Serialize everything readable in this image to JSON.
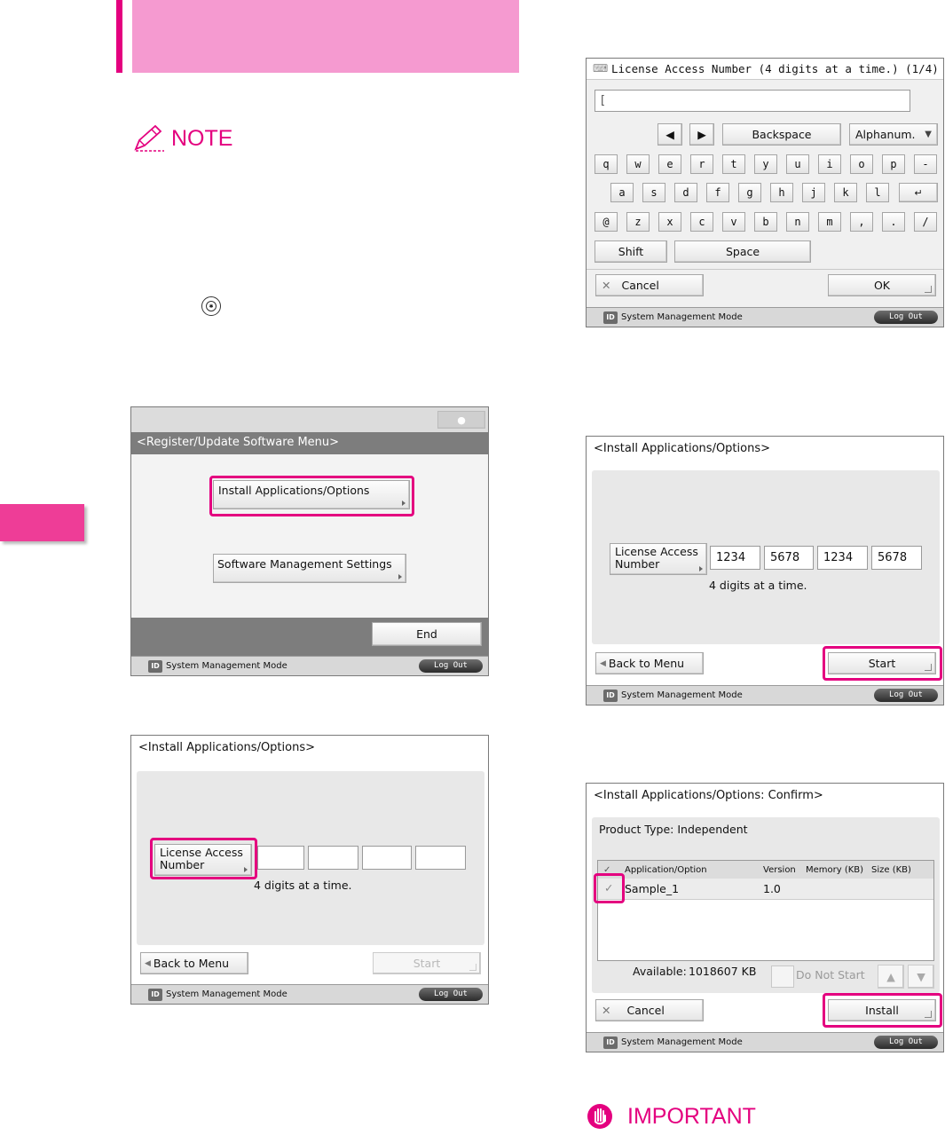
{
  "left_page": {
    "note_title": "NOTE",
    "screen_register": {
      "title": "<Register/Update Software Menu>",
      "install_button": "Install Applications/Options",
      "settings_button": "Software Management Settings",
      "end_button": "End",
      "status_text": "System Management Mode",
      "id_badge": "ID",
      "logout_button": "Log Out"
    },
    "screen_install_empty": {
      "title": "<Install Applications/Options>",
      "license_button_line1": "License Access",
      "license_button_line2": "Number",
      "hint": "4 digits at a time.",
      "back_button": "Back to Menu",
      "start_button": "Start",
      "status_text": "System Management Mode",
      "id_badge": "ID",
      "logout_button": "Log Out"
    }
  },
  "right_page": {
    "screen_keyboard": {
      "title": "License Access Number (4 digits at a time.) (1/4)",
      "input_value": "",
      "backspace": "Backspace",
      "mode": "Alphanum.",
      "row1": [
        "q",
        "w",
        "e",
        "r",
        "t",
        "y",
        "u",
        "i",
        "o",
        "p",
        "-"
      ],
      "row2": [
        "a",
        "s",
        "d",
        "f",
        "g",
        "h",
        "j",
        "k",
        "l"
      ],
      "row3": [
        "@",
        "z",
        "x",
        "c",
        "v",
        "b",
        "n",
        "m",
        ",",
        ".",
        "/"
      ],
      "shift": "Shift",
      "space": "Space",
      "cancel": "Cancel",
      "ok": "OK",
      "status_text": "System Management Mode",
      "id_badge": "ID",
      "logout_button": "Log Out"
    },
    "screen_install_filled": {
      "title": "<Install Applications/Options>",
      "license_button_line1": "License Access",
      "license_button_line2": "Number",
      "values": [
        "1234",
        "5678",
        "1234",
        "5678"
      ],
      "hint": "4 digits at a time.",
      "back_button": "Back to Menu",
      "start_button": "Start",
      "status_text": "System Management Mode",
      "id_badge": "ID",
      "logout_button": "Log Out"
    },
    "screen_confirm": {
      "title": "<Install Applications/Options: Confirm>",
      "product_type": "Product Type: Independent",
      "columns": [
        "Application/Option",
        "Version",
        "Memory (KB)",
        "Size (KB)"
      ],
      "rows": [
        {
          "name": "Sample_1",
          "version": "1.0",
          "checked": true
        }
      ],
      "available_label": "Available:",
      "available_value": "1018607 KB",
      "do_not_start": "Do Not Start",
      "cancel": "Cancel",
      "install": "Install",
      "status_text": "System Management Mode",
      "id_badge": "ID",
      "logout_button": "Log Out"
    },
    "important_title": "IMPORTANT"
  },
  "colors": {
    "accent": "#e4007f",
    "header_band": "#f59ad0",
    "side_tab": "#ee3d97"
  }
}
